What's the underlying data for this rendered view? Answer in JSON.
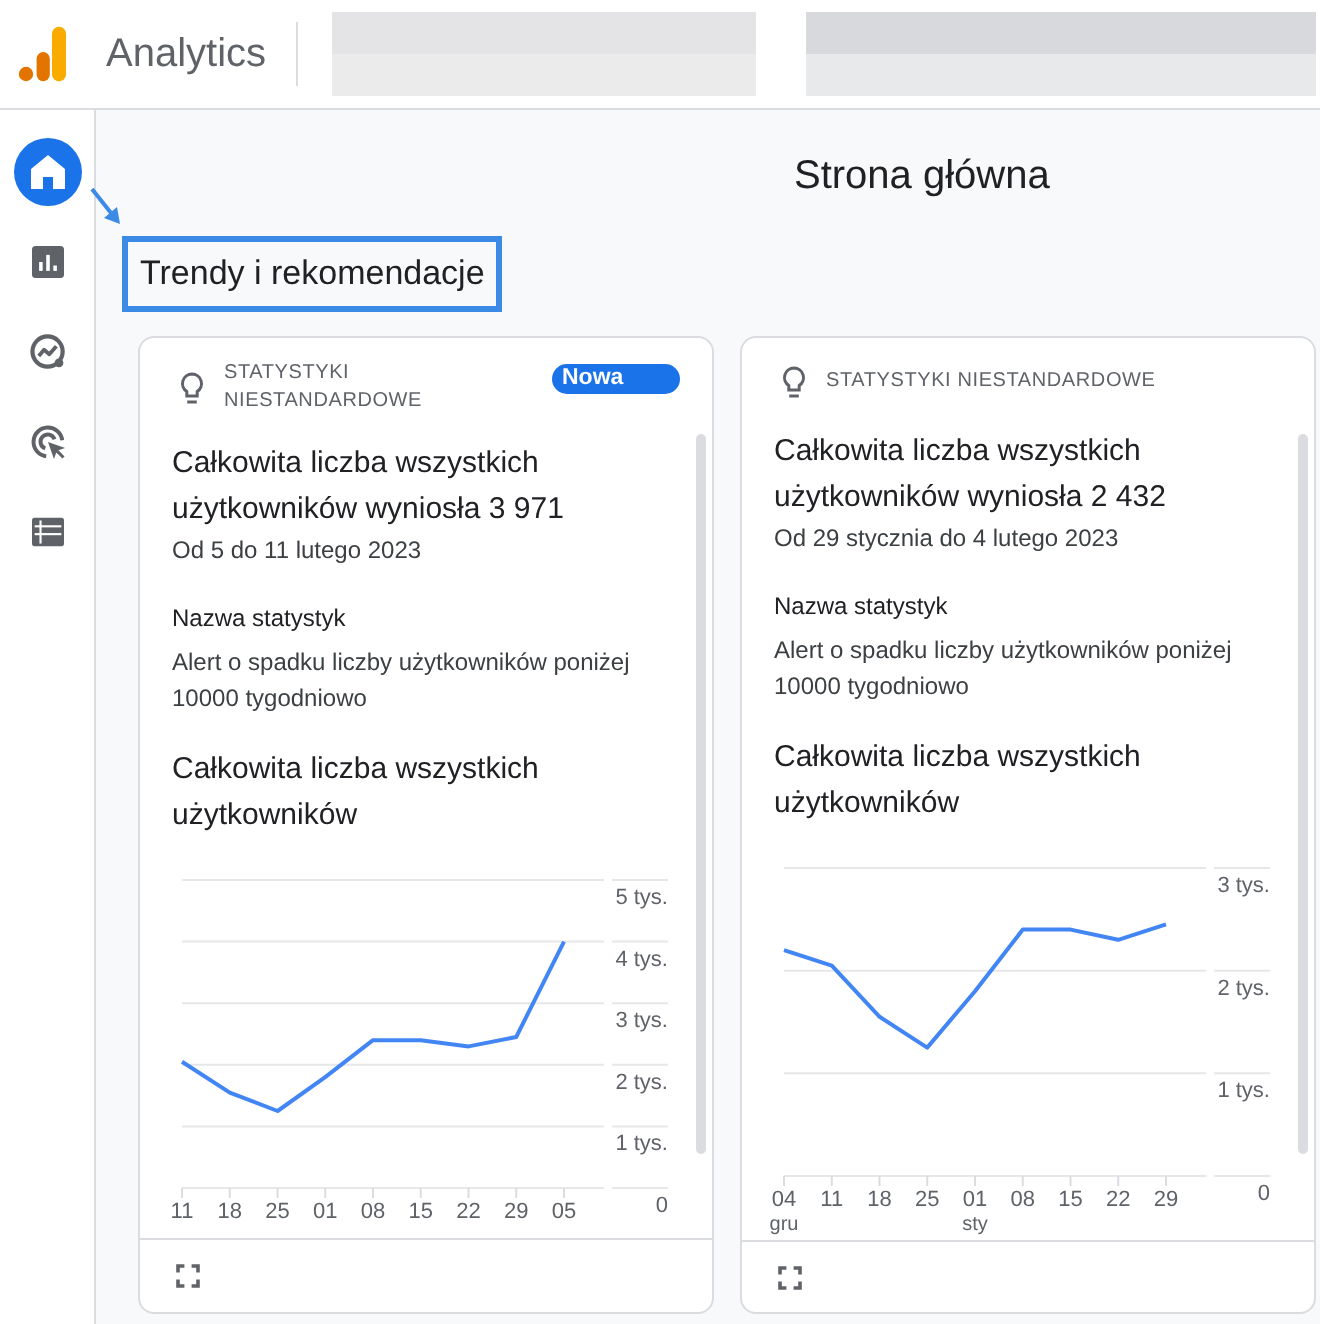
{
  "header": {
    "product_name": "Analytics"
  },
  "sidebar": {
    "items": [
      {
        "kind": "home",
        "selected": true
      },
      {
        "kind": "reports",
        "selected": false
      },
      {
        "kind": "explore",
        "selected": false
      },
      {
        "kind": "advertising",
        "selected": false
      },
      {
        "kind": "list",
        "selected": false
      }
    ]
  },
  "page": {
    "title": "Strona główna",
    "section": {
      "title": "Trendy i rekomendacje",
      "highlighted": true
    }
  },
  "cards": [
    {
      "category": "STATYSTYKI NIESTANDARDOWE",
      "badge": "Nowa",
      "headline": "Całkowita liczba wszystkich użytkowników wyniosła 3 971",
      "date_range": "Od 5 do 11 lutego 2023",
      "insight_label": "Nazwa statystyk",
      "insight_name": "Alert o spadku liczby użytkowników poniżej 10000 tygodniowo",
      "chart_data": {
        "type": "line",
        "title": "Całkowita liczba wszystkich użytkowników",
        "categories": [
          "11",
          "18",
          "25",
          "01",
          "08",
          "15",
          "22",
          "29",
          "05"
        ],
        "values": [
          2.05,
          1.55,
          1.25,
          1.8,
          2.4,
          2.4,
          2.3,
          2.45,
          4.0
        ],
        "ylim": [
          0,
          5
        ],
        "yticks": [
          {
            "value": 0,
            "label": "0"
          },
          {
            "value": 1,
            "label": "1 tys."
          },
          {
            "value": 2,
            "label": "2 tys."
          },
          {
            "value": 3,
            "label": "3 tys."
          },
          {
            "value": 4,
            "label": "4 tys."
          },
          {
            "value": 5,
            "label": "5 tys."
          }
        ],
        "grid": true
      }
    },
    {
      "category": "STATYSTYKI NIESTANDARDOWE",
      "headline": "Całkowita liczba wszystkich użytkowników wyniosła 2 432",
      "date_range": "Od 29 stycznia do 4 lutego 2023",
      "insight_label": "Nazwa statystyk",
      "insight_name": "Alert o spadku liczby użytkowników poniżej 10000 tygodniowo",
      "chart_data": {
        "type": "line",
        "title": "Całkowita liczba wszystkich użytkowników",
        "categories": [
          "04 gru",
          "11",
          "18",
          "25",
          "01 sty",
          "08",
          "15",
          "22",
          "29"
        ],
        "values": [
          2.2,
          2.05,
          1.55,
          1.25,
          1.8,
          2.4,
          2.4,
          2.3,
          2.45
        ],
        "ylim": [
          0,
          3
        ],
        "yticks": [
          {
            "value": 0,
            "label": "0"
          },
          {
            "value": 1,
            "label": "1 tys."
          },
          {
            "value": 2,
            "label": "2 tys."
          },
          {
            "value": 3,
            "label": "3 tys."
          }
        ],
        "grid": true
      }
    }
  ]
}
